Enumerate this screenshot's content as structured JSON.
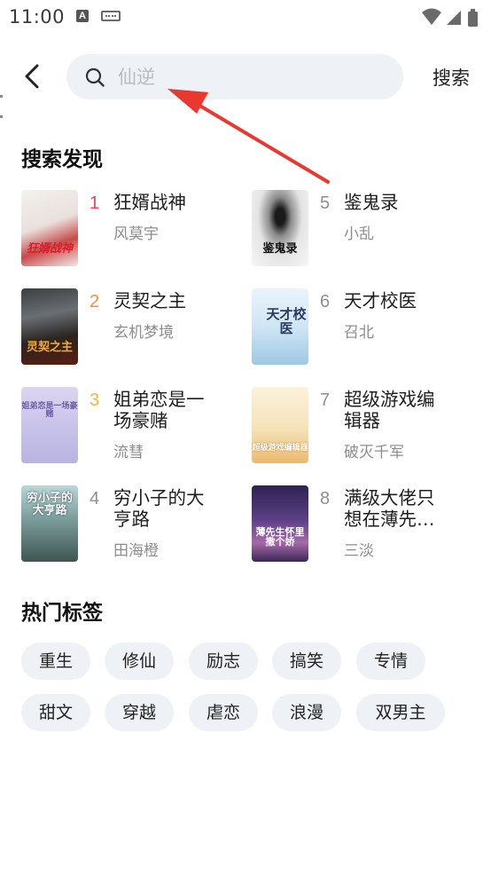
{
  "status_bar": {
    "time": "11:00",
    "icons": [
      "notification-a-icon",
      "keyboard-icon",
      "wifi-icon",
      "signal-icon",
      "battery-icon"
    ]
  },
  "search": {
    "placeholder": "仙逆",
    "value": "",
    "button_label": "搜索",
    "icons": [
      "back-arrow-icon",
      "search-icon"
    ]
  },
  "discover": {
    "title": "搜索发现",
    "books": [
      {
        "rank": "1",
        "title": "狂婿战神",
        "author": "风莫宇",
        "rank_color": "#f2425a",
        "cover_text": "狂婿战神"
      },
      {
        "rank": "2",
        "title": "灵契之主",
        "author": "玄机梦境",
        "rank_color": "#ff8c3a",
        "cover_text": "灵契之主"
      },
      {
        "rank": "3",
        "title": "姐弟恋是一场豪赌",
        "author": "流彗",
        "rank_color": "#ffb13d",
        "cover_text": "姐弟恋是一场豪赌"
      },
      {
        "rank": "4",
        "title": "穷小子的大亨路",
        "author": "田海橙",
        "rank_color": "#8f8f8f",
        "cover_text": "穷小子的大亨路"
      },
      {
        "rank": "5",
        "title": "鉴鬼录",
        "author": "小乱",
        "rank_color": "#8f8f8f",
        "cover_text": "鉴鬼录"
      },
      {
        "rank": "6",
        "title": "天才校医",
        "author": "召北",
        "rank_color": "#8f8f8f",
        "cover_text": "天才校医"
      },
      {
        "rank": "7",
        "title": "超级游戏编辑器",
        "author": "破灭千军",
        "rank_color": "#8f8f8f",
        "cover_text": "超级游戏编辑器"
      },
      {
        "rank": "8",
        "title": "满级大佬只想在薄先生怀里撒个娇",
        "author": "三淡",
        "rank_color": "#8f8f8f",
        "cover_text": "薄先生怀里撒个娇"
      }
    ]
  },
  "hot_tags": {
    "title": "热门标签",
    "tags": [
      "重生",
      "修仙",
      "励志",
      "搞笑",
      "专情",
      "甜文",
      "穿越",
      "虐恋",
      "浪漫",
      "双男主"
    ]
  },
  "annotation": {
    "color": "#e8382f",
    "type": "red-arrow-pointing-to-search-input"
  }
}
